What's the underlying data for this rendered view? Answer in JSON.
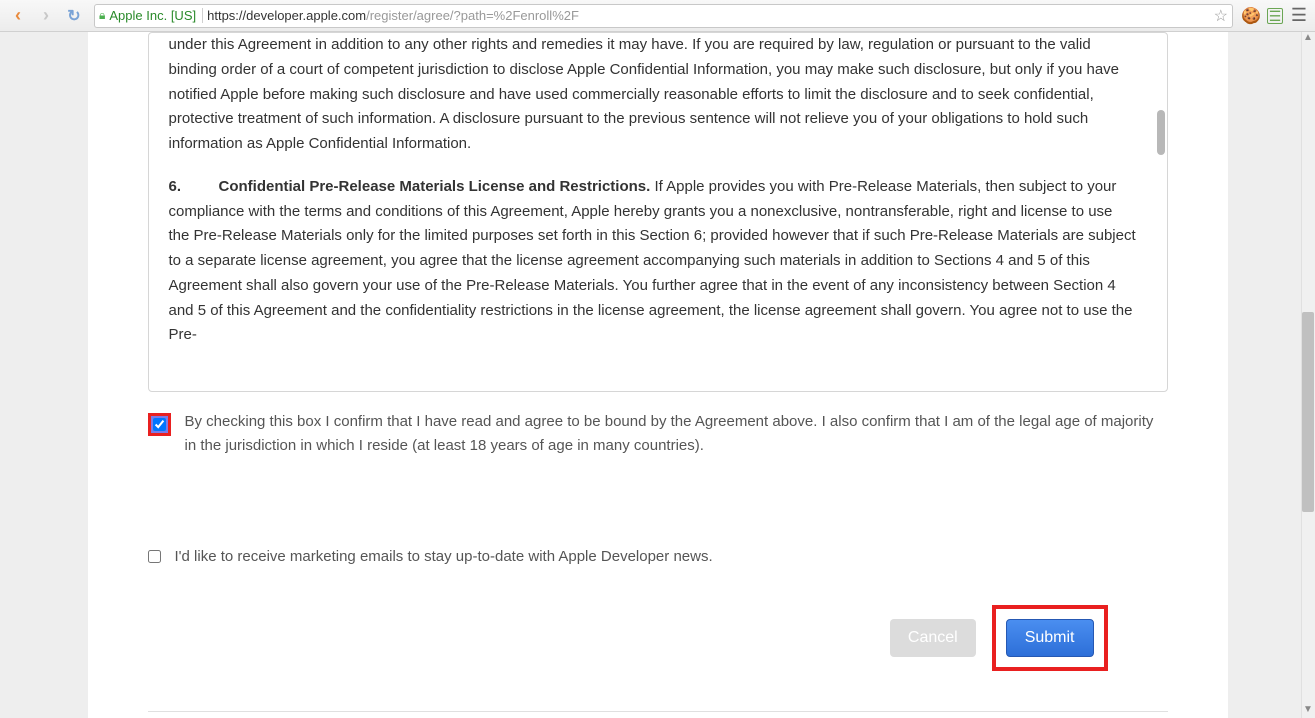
{
  "browser": {
    "identity": "Apple Inc. [US]",
    "url_host": "https://developer.apple.com",
    "url_path": "/register/agree/?path=%2Fenroll%2F"
  },
  "agreement": {
    "para1": "under this Agreement in addition to any other rights and remedies it may have.  If you are required by law, regulation or pursuant to the valid binding order of a court of competent jurisdiction to disclose Apple Confidential Information, you may make such disclosure, but only if you have notified Apple before making such disclosure and have used commercially reasonable efforts to limit the disclosure and to seek confidential, protective treatment of such information.  A disclosure pursuant to the previous sentence will not relieve you of your obligations to hold such information as Apple Confidential Information.",
    "section6_num": "6.",
    "section6_title": "Confidential Pre-Release Materials License and Restrictions.",
    "section6_body": "  If Apple provides you with Pre-Release Materials, then subject to your compliance with the terms and conditions of this Agreement, Apple hereby grants you a nonexclusive, nontransferable, right and license to use the Pre-Release Materials only for the limited purposes set forth in this Section 6; provided however that if such Pre-Release Materials are subject to a separate license agreement, you agree that the license agreement accompanying such materials in addition to Sections 4 and 5 of this Agreement shall also govern your use of the Pre-Release Materials.  You further agree that in the event of any inconsistency between Section 4 and 5 of this Agreement and the confidentiality restrictions in the license agreement, the license agreement shall govern.  You agree not to use the Pre-"
  },
  "consent": {
    "agree_label": "By checking this box I confirm that I have read and agree to be bound by the Agreement above. I also confirm that I am of the legal age of majority in the jurisdiction in which I reside (at least 18 years of age in many countries).",
    "marketing_label": "I'd like to receive marketing emails to stay up-to-date with Apple Developer news."
  },
  "buttons": {
    "cancel": "Cancel",
    "submit": "Submit"
  }
}
